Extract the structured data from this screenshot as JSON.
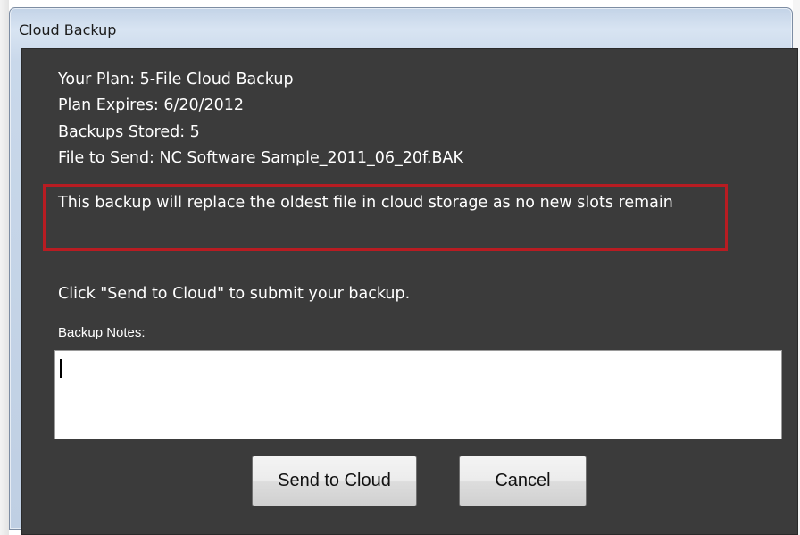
{
  "window": {
    "title": "Cloud Backup"
  },
  "info": {
    "plan": "Your Plan: 5-File Cloud Backup",
    "expires": "Plan Expires: 6/20/2012",
    "stored": "Backups Stored: 5",
    "file": "File to Send: NC Software Sample_2011_06_20f.BAK"
  },
  "warning": {
    "text": "This backup will replace the oldest file in cloud storage as no new slots remain",
    "border_color": "#b81c22"
  },
  "instruction": "Click \"Send to Cloud\" to submit your backup.",
  "notes": {
    "label": "Backup Notes:",
    "value": ""
  },
  "buttons": {
    "send": "Send to Cloud",
    "cancel": "Cancel"
  },
  "colors": {
    "client_background": "#3b3b3b",
    "text": "#ffffff"
  }
}
